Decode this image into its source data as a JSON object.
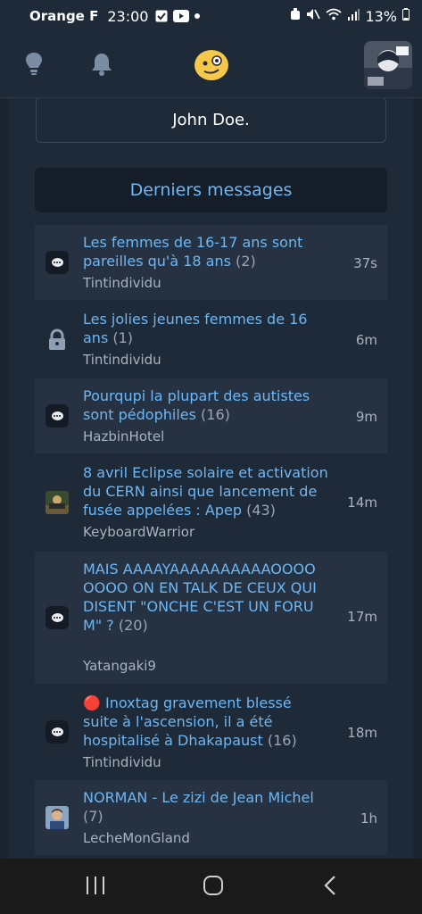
{
  "status_bar": {
    "carrier": "Orange F",
    "time": "23:00",
    "battery": "13%"
  },
  "top_nav": {
    "icons": [
      "lightbulb-icon",
      "bell-icon",
      "smiley-icon"
    ]
  },
  "user_card": {
    "name": "John Doe."
  },
  "section": {
    "title": "Derniers messages"
  },
  "topics": [
    {
      "title": "Les femmes de 16-17 ans sont pareilles qu'à 18 ans",
      "count": "(2)",
      "author": "Tintindividu",
      "time": "37s",
      "icon": "chat-bubble-icon"
    },
    {
      "title": "Les jolies jeunes femmes de 16 ans",
      "count": "(1)",
      "author": "Tintindividu",
      "time": "6m",
      "icon": "lock-icon"
    },
    {
      "title": "Pourqupi la plupart des autistes sont pédophiles",
      "count": "(16)",
      "author": "HazbinHotel",
      "time": "9m",
      "icon": "chat-bubble-icon"
    },
    {
      "title": "8 avril Eclipse solaire et activation du CERN ainsi que lancement de fusée appelées : Apep",
      "count": "(43)",
      "author": "KeyboardWarrior",
      "time": "14m",
      "icon": "thumbnail-icon"
    },
    {
      "title": "MAIS AAAAYAAAAAAAAAAOOOOOOOO ON EN TALK DE CEUX QUI DISENT \"ONCHE C'EST UN FORUM\" ?",
      "count": "(20)",
      "author": "Yatangaki9",
      "time": "17m",
      "icon": "chat-bubble-icon"
    },
    {
      "title": "Inoxtag gravement blessé suite à l'ascension, il a été hospitalisé à Dhakapaust",
      "count": "(16)",
      "author": "Tintindividu",
      "time": "18m",
      "icon": "chat-bubble-icon",
      "emoji": "🔴"
    },
    {
      "title": "NORMAN - Le zizi de Jean Michel",
      "count": "(7)",
      "author": "LecheMonGland",
      "time": "1h",
      "icon": "avatar-thumbnail-icon"
    }
  ]
}
